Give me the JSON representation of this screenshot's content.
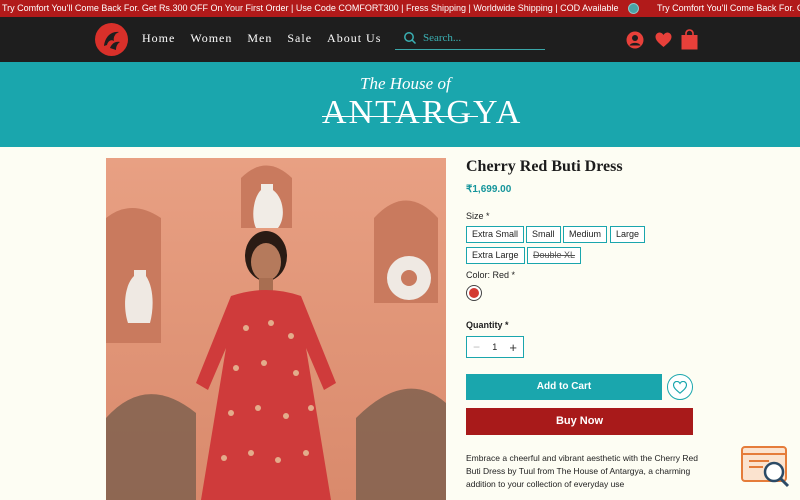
{
  "announcement": {
    "text": "Try Comfort You'll Come Back For. Get Rs.300 OFF On Your First Order | Use Code COMFORT300 | Fress Shipping | Worldwide Shipping | COD Available",
    "text_repeat": "Try Comfort You'll Come Back For. Get Rs.300 OFF"
  },
  "nav": {
    "links": [
      "Home",
      "Women",
      "Men",
      "Sale",
      "About Us"
    ],
    "search_placeholder": "Search...",
    "icons": [
      "search-icon",
      "user-icon",
      "heart-icon",
      "shopping-bag-icon"
    ]
  },
  "banner": {
    "brand_top": "The House of",
    "brand_main": "ANTARGYA"
  },
  "product": {
    "title": "Cherry Red Buti Dress",
    "price": "₹1,699.00",
    "size_label": "Size *",
    "sizes": [
      {
        "label": "Extra Small",
        "available": true
      },
      {
        "label": "Small",
        "available": true
      },
      {
        "label": "Medium",
        "available": true
      },
      {
        "label": "Large",
        "available": true
      },
      {
        "label": "Extra Large",
        "available": true
      },
      {
        "label": "Double XL",
        "available": false
      }
    ],
    "color_label": "Color: Red *",
    "color_swatch": "#d33a33",
    "quantity_label": "Quantity *",
    "quantity": "1",
    "add_to_cart": "Add to Cart",
    "buy_now": "Buy Now",
    "description": "Embrace a cheerful and vibrant aesthetic with the Cherry Red Buti Dress by Tuul from The House of Antargya, a charming addition to your collection of everyday use"
  },
  "colors": {
    "announcement_bg": "#b11a1a",
    "nav_bg": "#1e1e1e",
    "teal": "#1aa6ad",
    "buy_now": "#a81a1a"
  }
}
